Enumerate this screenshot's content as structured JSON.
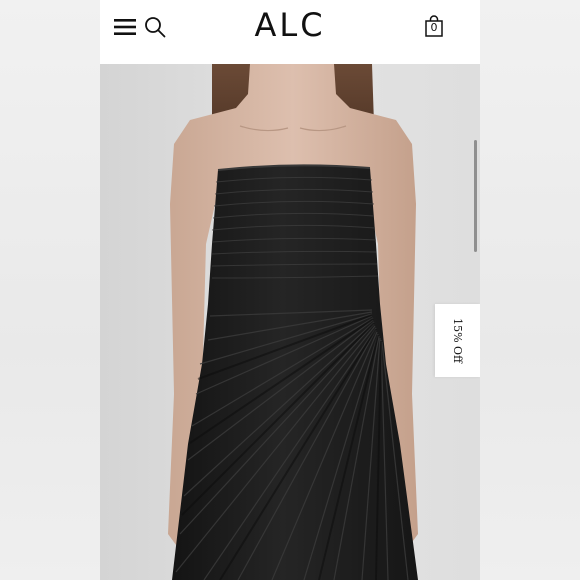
{
  "header": {
    "brand": "ALC",
    "bag_count": "0",
    "icons": [
      "menu-icon",
      "search-icon",
      "shopping-bag-icon"
    ]
  },
  "promo": {
    "label": "15% Off"
  },
  "colors": {
    "background": "#ffffff",
    "text": "#111111",
    "dress": "#1a1a1a",
    "backdrop": "#dcdcdc"
  }
}
